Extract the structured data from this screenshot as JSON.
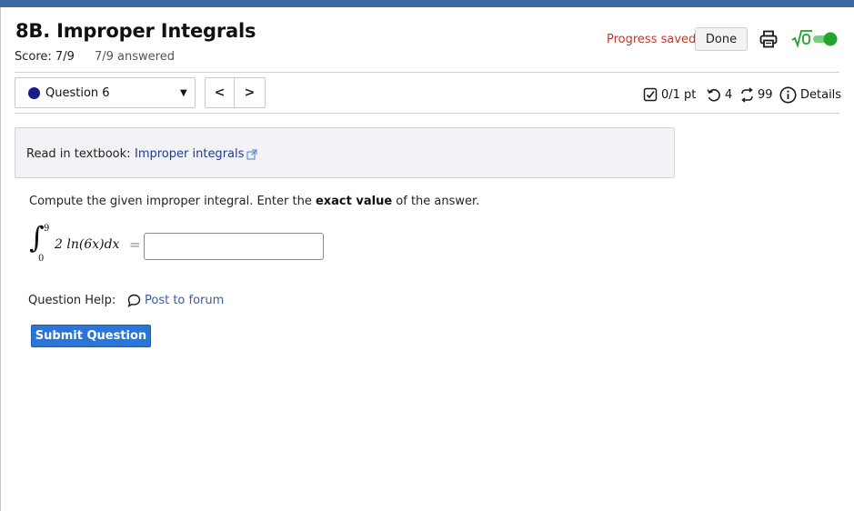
{
  "header": {
    "title": "8B. Improper Integrals",
    "score": "Score: 7/9",
    "answered": "7/9 answered",
    "progress_saved": "Progress saved",
    "done_label": "Done"
  },
  "question_nav": {
    "selected": "Question 6",
    "prev_glyph": "<",
    "next_glyph": ">"
  },
  "question_meta": {
    "points": "0/1 pt",
    "attempts": "4",
    "retries": "99",
    "details_label": "Details"
  },
  "textbook": {
    "label": "Read in textbook:",
    "link": "Improper integrals"
  },
  "question": {
    "prompt_pre": "Compute the given improper integral. Enter the ",
    "prompt_bold": "exact value",
    "prompt_post": " of the answer.",
    "integral": {
      "upper": "9",
      "lower": "0",
      "integrand": "2 ln(6x)dx",
      "equals": "="
    },
    "answer_value": ""
  },
  "help": {
    "label": "Question Help:",
    "forum_link": "Post to forum"
  },
  "submit_label": "Submit Question",
  "icons": {
    "print": "print-icon",
    "math_toggle": "sqrt-icon",
    "toggle": "toggle-switch",
    "points": "checkbox-icon",
    "attempts": "undo-icon",
    "retries": "retry-icon",
    "details": "info-icon",
    "external": "external-link-icon",
    "forum": "speech-bubble-icon"
  },
  "colors": {
    "topbar": "#3d6a9e",
    "progress_saved": "#c0392b",
    "link": "#1d3b8f",
    "submit_bg": "#2b74d8",
    "toggle_on": "#22a52a",
    "question_dot": "#1a1a8c"
  }
}
